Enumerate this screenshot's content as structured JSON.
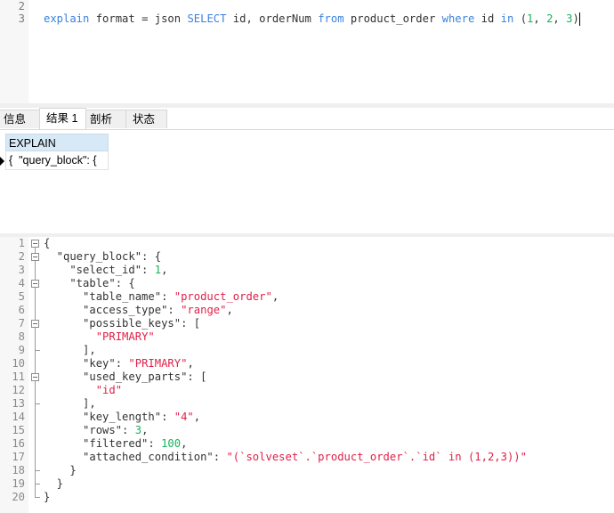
{
  "sql_editor": {
    "lines": [
      {
        "number": "2",
        "tokens": []
      },
      {
        "number": "3",
        "tokens": [
          {
            "t": "explain",
            "c": "kw"
          },
          {
            "t": " format = json ",
            "c": ""
          },
          {
            "t": "SELECT",
            "c": "kw"
          },
          {
            "t": " id, orderNum ",
            "c": ""
          },
          {
            "t": "from",
            "c": "kw"
          },
          {
            "t": " product_order ",
            "c": ""
          },
          {
            "t": "where",
            "c": "kw"
          },
          {
            "t": " id ",
            "c": ""
          },
          {
            "t": "in",
            "c": "kw"
          },
          {
            "t": " (",
            "c": ""
          },
          {
            "t": "1",
            "c": "num"
          },
          {
            "t": ", ",
            "c": ""
          },
          {
            "t": "2",
            "c": "num"
          },
          {
            "t": ", ",
            "c": ""
          },
          {
            "t": "3",
            "c": "num"
          },
          {
            "t": ")",
            "c": ""
          }
        ]
      }
    ]
  },
  "tabs": [
    {
      "label": "信息",
      "active": false
    },
    {
      "label": "结果 1",
      "active": true
    },
    {
      "label": "剖析",
      "active": false
    },
    {
      "label": "状态",
      "active": false
    }
  ],
  "result_grid": {
    "column_header": "EXPLAIN",
    "row_value": "{  \"query_block\": {"
  },
  "json_viewer": {
    "lines": [
      {
        "n": "1",
        "tokens": [
          {
            "t": "{",
            "c": ""
          }
        ]
      },
      {
        "n": "2",
        "tokens": [
          {
            "t": "  \"query_block\": {",
            "c": ""
          }
        ]
      },
      {
        "n": "3",
        "tokens": [
          {
            "t": "    \"select_id\": ",
            "c": ""
          },
          {
            "t": "1",
            "c": "jnum"
          },
          {
            "t": ",",
            "c": ""
          }
        ]
      },
      {
        "n": "4",
        "tokens": [
          {
            "t": "    \"table\": {",
            "c": ""
          }
        ]
      },
      {
        "n": "5",
        "tokens": [
          {
            "t": "      \"table_name\": ",
            "c": ""
          },
          {
            "t": "\"product_order\"",
            "c": "jstr"
          },
          {
            "t": ",",
            "c": ""
          }
        ]
      },
      {
        "n": "6",
        "tokens": [
          {
            "t": "      \"access_type\": ",
            "c": ""
          },
          {
            "t": "\"range\"",
            "c": "jstr"
          },
          {
            "t": ",",
            "c": ""
          }
        ]
      },
      {
        "n": "7",
        "tokens": [
          {
            "t": "      \"possible_keys\": [",
            "c": ""
          }
        ]
      },
      {
        "n": "8",
        "tokens": [
          {
            "t": "        ",
            "c": ""
          },
          {
            "t": "\"PRIMARY\"",
            "c": "jstr"
          }
        ]
      },
      {
        "n": "9",
        "tokens": [
          {
            "t": "      ],",
            "c": ""
          }
        ]
      },
      {
        "n": "10",
        "tokens": [
          {
            "t": "      \"key\": ",
            "c": ""
          },
          {
            "t": "\"PRIMARY\"",
            "c": "jstr"
          },
          {
            "t": ",",
            "c": ""
          }
        ]
      },
      {
        "n": "11",
        "tokens": [
          {
            "t": "      \"used_key_parts\": [",
            "c": ""
          }
        ]
      },
      {
        "n": "12",
        "tokens": [
          {
            "t": "        ",
            "c": ""
          },
          {
            "t": "\"id\"",
            "c": "jstr"
          }
        ]
      },
      {
        "n": "13",
        "tokens": [
          {
            "t": "      ],",
            "c": ""
          }
        ]
      },
      {
        "n": "14",
        "tokens": [
          {
            "t": "      \"key_length\": ",
            "c": ""
          },
          {
            "t": "\"4\"",
            "c": "jstr"
          },
          {
            "t": ",",
            "c": ""
          }
        ]
      },
      {
        "n": "15",
        "tokens": [
          {
            "t": "      \"rows\": ",
            "c": ""
          },
          {
            "t": "3",
            "c": "jnum"
          },
          {
            "t": ",",
            "c": ""
          }
        ]
      },
      {
        "n": "16",
        "tokens": [
          {
            "t": "      \"filtered\": ",
            "c": ""
          },
          {
            "t": "100",
            "c": "jnum"
          },
          {
            "t": ",",
            "c": ""
          }
        ]
      },
      {
        "n": "17",
        "tokens": [
          {
            "t": "      \"attached_condition\": ",
            "c": ""
          },
          {
            "t": "\"(`solveset`.`product_order`.`id` in (1,2,3))\"",
            "c": "jstr"
          }
        ]
      },
      {
        "n": "18",
        "tokens": [
          {
            "t": "    }",
            "c": ""
          }
        ]
      },
      {
        "n": "19",
        "tokens": [
          {
            "t": "  }",
            "c": ""
          }
        ]
      },
      {
        "n": "20",
        "tokens": [
          {
            "t": "}",
            "c": ""
          }
        ]
      }
    ],
    "folds": [
      {
        "start": 1,
        "end": 20
      },
      {
        "start": 2,
        "end": 19
      },
      {
        "start": 4,
        "end": 18
      },
      {
        "start": 7,
        "end": 9
      },
      {
        "start": 11,
        "end": 13
      }
    ]
  }
}
